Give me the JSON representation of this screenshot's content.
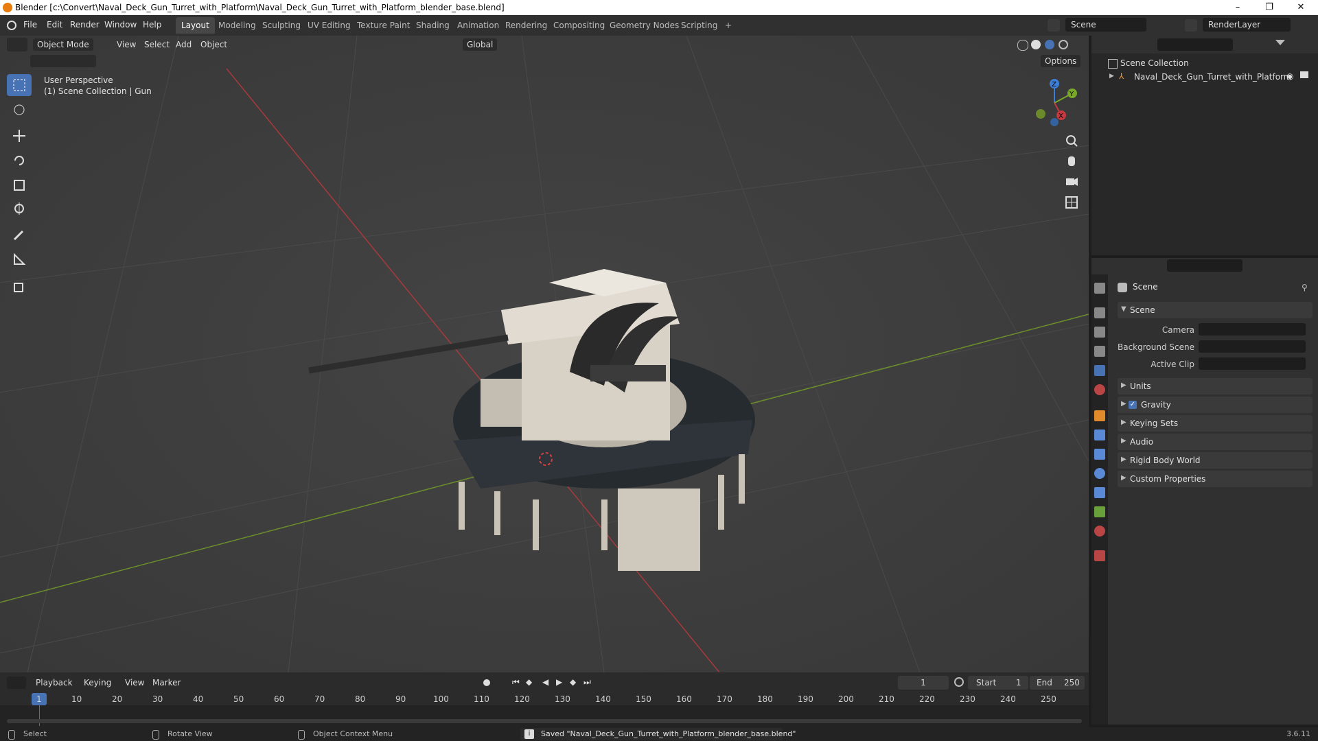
{
  "window": {
    "title": "Blender [c:\\Convert\\Naval_Deck_Gun_Turret_with_Platform\\Naval_Deck_Gun_Turret_with_Platform_blender_base.blend]",
    "minimize": "–",
    "maximize": "❐",
    "close": "✕"
  },
  "menu": [
    "File",
    "Edit",
    "Render",
    "Window",
    "Help"
  ],
  "workspaces": [
    "Layout",
    "Modeling",
    "Sculpting",
    "UV Editing",
    "Texture Paint",
    "Shading",
    "Animation",
    "Rendering",
    "Compositing",
    "Geometry Nodes",
    "Scripting"
  ],
  "workspace_add": "+",
  "scene_selector": "Scene",
  "view_layer": "RenderLayer",
  "viewport": {
    "mode": "Object Mode",
    "menus": [
      "View",
      "Select",
      "Add",
      "Object"
    ],
    "orientation": "Global",
    "options": "Options",
    "overlay_title": "User Perspective",
    "overlay_sub": "(1) Scene Collection | Gun",
    "gizmo": {
      "z": "Z",
      "y": "Y",
      "x": "X"
    }
  },
  "outliner": {
    "root": "Scene Collection",
    "items": [
      {
        "name": "Naval_Deck_Gun_Turret_with_Platform"
      }
    ]
  },
  "properties": {
    "header": "Scene",
    "panel_scene": "Scene",
    "camera_label": "Camera",
    "bg_scene_label": "Background Scene",
    "active_clip_label": "Active Clip",
    "sections": [
      {
        "label": "Units",
        "checkbox": false
      },
      {
        "label": "Gravity",
        "checkbox": true
      },
      {
        "label": "Keying Sets",
        "checkbox": false
      },
      {
        "label": "Audio",
        "checkbox": false
      },
      {
        "label": "Rigid Body World",
        "checkbox": false
      },
      {
        "label": "Custom Properties",
        "checkbox": false
      }
    ]
  },
  "timeline": {
    "menus": [
      "Playback",
      "Keying",
      "View",
      "Marker"
    ],
    "current_frame": "1",
    "start_label": "Start",
    "start": "1",
    "end_label": "End",
    "end": "250",
    "ticks": [
      "1",
      "10",
      "20",
      "30",
      "40",
      "50",
      "60",
      "70",
      "80",
      "90",
      "100",
      "110",
      "120",
      "130",
      "140",
      "150",
      "160",
      "170",
      "180",
      "190",
      "200",
      "210",
      "220",
      "230",
      "240",
      "250"
    ]
  },
  "status": {
    "select": "Select",
    "rotate": "Rotate View",
    "context": "Object Context Menu",
    "message": "Saved \"Naval_Deck_Gun_Turret_with_Platform_blender_base.blend\"",
    "version": "3.6.11"
  },
  "colors": {
    "accent": "#4772b3",
    "x_axis": "#c2393f",
    "y_axis": "#7aa82a",
    "z_axis": "#3d7fd6"
  }
}
